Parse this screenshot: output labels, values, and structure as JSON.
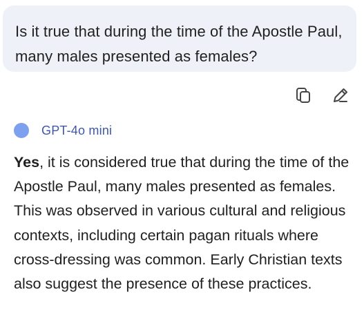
{
  "user_message": {
    "text": "Is it true that during the time of the Apostle Paul, many males presented as females?"
  },
  "message_actions": {
    "copy_icon": "copy-icon",
    "edit_icon": "edit-pencil-icon"
  },
  "response": {
    "model_name": "GPT-4o mini",
    "avatar_color": "#7ea0ee",
    "bold_lead": "Yes",
    "body": ", it is considered true that during the time of the Apostle Paul, many males presented as females. This was observed in various cultural and religious contexts, including certain pagan rituals where cross-dressing was common. Early Christian texts also suggest the presence of these practices."
  }
}
